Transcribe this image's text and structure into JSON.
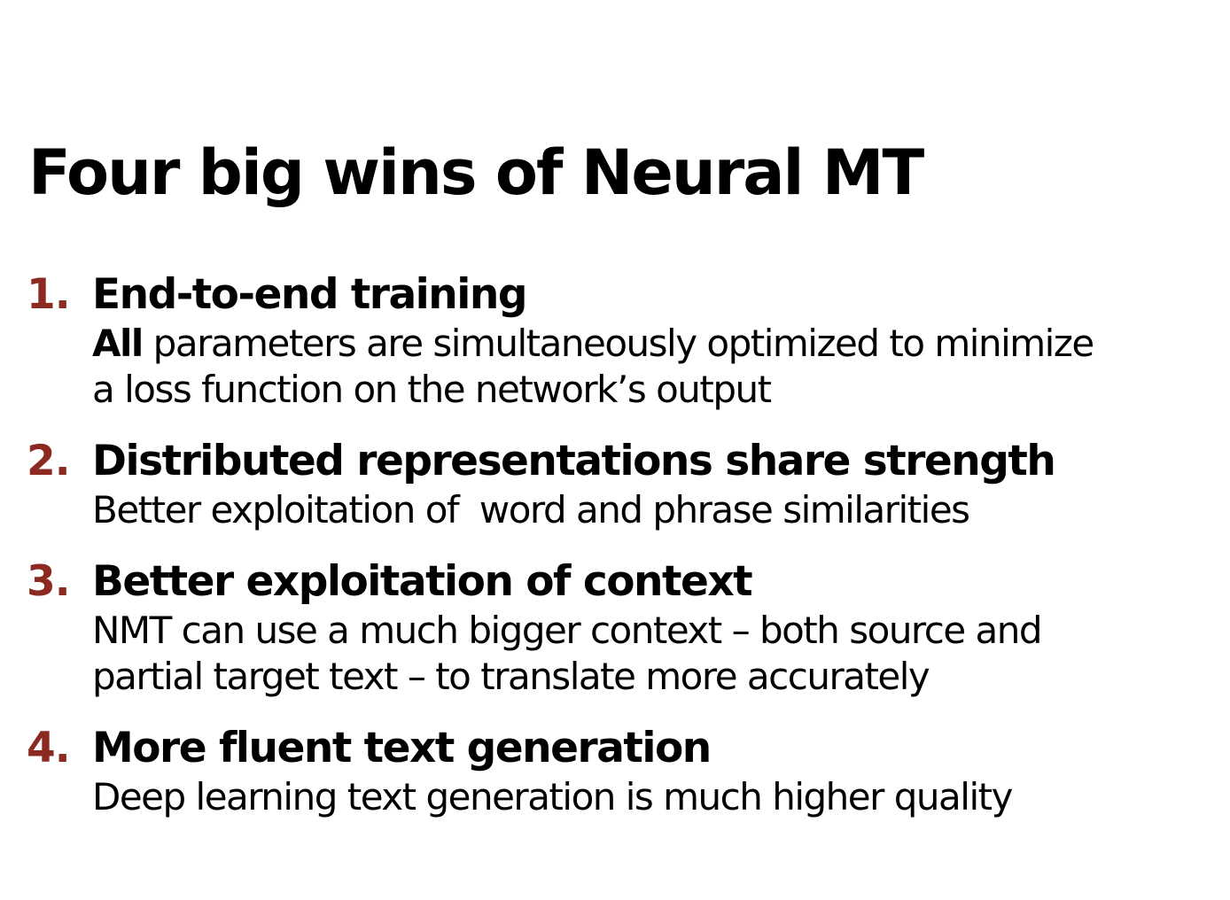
{
  "title": "Four big wins of Neural MT",
  "colors": {
    "number_accent": "#8c2a22",
    "text": "#000000",
    "background": "#ffffff"
  },
  "items": [
    {
      "number": "1.",
      "heading": "End-to-end training",
      "desc_emphasis": "All",
      "desc_lines": [
        "parameters are simultaneously optimized to minimize",
        "a loss function on the network’s output"
      ]
    },
    {
      "number": "2.",
      "heading": "Distributed representations share strength",
      "desc_lines": [
        "Better exploitation of  word and phrase similarities"
      ]
    },
    {
      "number": "3.",
      "heading": "Better exploitation of context",
      "desc_lines": [
        "NMT can use a much bigger context – both source and",
        "partial target text – to translate more accurately"
      ]
    },
    {
      "number": "4.",
      "heading": "More fluent text generation",
      "desc_lines": [
        "Deep learning text generation is much higher quality"
      ]
    }
  ]
}
